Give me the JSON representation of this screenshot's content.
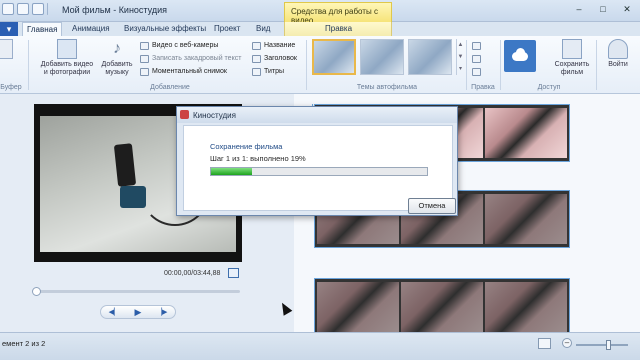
{
  "window": {
    "title": "Мой фильм - Киностудия",
    "contextual_group": "Средства для работы с видео"
  },
  "tabs": {
    "file": "▾",
    "items": [
      "Главная",
      "Анимация",
      "Визуальные эффекты",
      "Проект",
      "Вид"
    ],
    "contextual": "Правка",
    "active": "Главная"
  },
  "ribbon": {
    "clipboard_group": "Буфер",
    "add_video_label": "Добавить видео и фотографии",
    "add_music_label": "Добавить музыку",
    "webcam_label": "Видео с веб-камеры",
    "narration_label": "Записать закадровый текст",
    "snapshot_label": "Моментальный снимок",
    "title_label": "Название",
    "caption_label": "Заголовок",
    "credits_label": "Титры",
    "add_group": "Добавление",
    "themes_group": "Темы автофильма",
    "editing_group": "Правка",
    "share_group": "Доступ",
    "save_movie_label": "Сохранить фильм",
    "signin_label": "Войти"
  },
  "preview": {
    "time": "00:00,00/03:44,88"
  },
  "dialog": {
    "title": "Киностудия",
    "heading": "Сохранение фильма",
    "step": "Шаг 1 из 1: выполнено 19%",
    "progress_percent": 19,
    "cancel_label": "Отмена"
  },
  "statusbar": {
    "text": "емент 2 из 2"
  },
  "colors": {
    "accent": "#2b5fb3",
    "progress": "#1ea31e",
    "contextual": "#f6e479"
  }
}
